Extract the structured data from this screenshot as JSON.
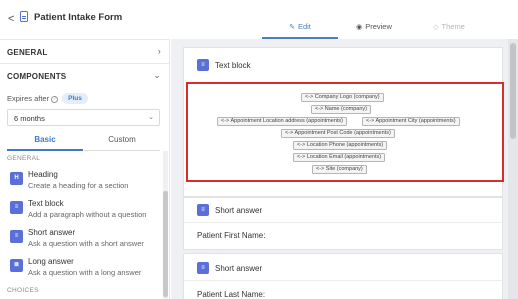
{
  "header": {
    "back_glyph": "<",
    "title": "Patient Intake Form",
    "tabs": [
      {
        "label": "Edit",
        "icon": "pencil-icon"
      },
      {
        "label": "Preview",
        "icon": "eye-icon"
      },
      {
        "label": "Theme",
        "icon": "tag-icon"
      }
    ]
  },
  "sidebar": {
    "general_label": "GENERAL",
    "components_label": "COMPONENTS",
    "expires_label": "Expires after",
    "plus_badge": "Plus",
    "expires_value": "6 months",
    "subtabs": [
      "Basic",
      "Custom"
    ],
    "group_general": "GENERAL",
    "group_choices": "CHOICES",
    "components": [
      {
        "name": "Heading",
        "desc": "Create a heading for a section",
        "icon": "heading-icon"
      },
      {
        "name": "Text block",
        "desc": "Add a paragraph without a question",
        "icon": "text-block-icon"
      },
      {
        "name": "Short answer",
        "desc": "Ask a question with a short answer",
        "icon": "short-answer-icon"
      },
      {
        "name": "Long answer",
        "desc": "Ask a question with a long answer",
        "icon": "long-answer-icon"
      }
    ]
  },
  "canvas": {
    "text_block": {
      "title": "Text block",
      "chips": [
        "<-> Company Logo (company)",
        "<-> Name (company)",
        "<-> Appointment Location address (appointments)",
        "<-> Appointment City (appointments)",
        "<-> Appointment Post Code (appointments)",
        "<-> Location Phone (appointments)",
        "<-> Location Email (appointments)",
        "<-> Site (company)"
      ]
    },
    "short_answer_1": {
      "title": "Short answer",
      "field": "Patient First Name:"
    },
    "short_answer_2": {
      "title": "Short answer",
      "field": "Patient Last Name:"
    }
  },
  "colors": {
    "accent": "#5a6fd8",
    "active_tab": "#4a7fc1",
    "highlight_border": "#d62d2d"
  }
}
